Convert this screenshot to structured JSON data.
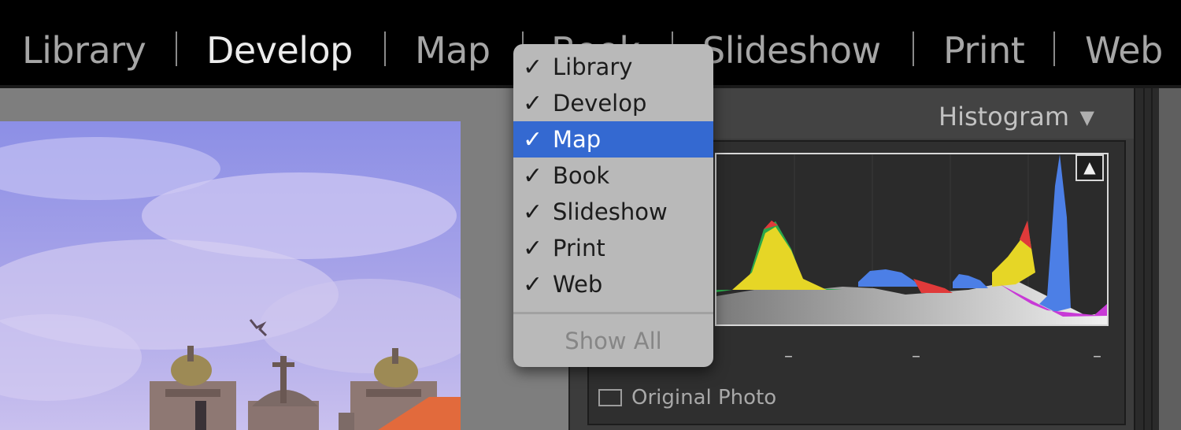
{
  "module_bar": {
    "items": [
      {
        "label": "Library",
        "active": false
      },
      {
        "label": "Develop",
        "active": true
      },
      {
        "label": "Map",
        "active": false
      },
      {
        "label": "Book",
        "active": false
      },
      {
        "label": "Slideshow",
        "active": false
      },
      {
        "label": "Print",
        "active": false
      },
      {
        "label": "Web",
        "active": false
      }
    ]
  },
  "context_menu": {
    "items": [
      {
        "check": "✓",
        "label": "Library"
      },
      {
        "check": "✓",
        "label": "Develop"
      },
      {
        "check": "✓",
        "label": "Map"
      },
      {
        "check": "✓",
        "label": "Book"
      },
      {
        "check": "✓",
        "label": "Slideshow"
      },
      {
        "check": "✓",
        "label": "Print"
      },
      {
        "check": "✓",
        "label": "Web"
      }
    ],
    "selected_index": 2,
    "show_all_label": "Show All",
    "highlight_color": "#3469d1"
  },
  "histogram_panel": {
    "title": "Histogram",
    "collapse_icon": "triangle-down-icon",
    "clip_icon": "triangle-up-icon",
    "tick_labels": [
      "–",
      "–",
      "–"
    ],
    "original_photo_label": "Original Photo"
  },
  "icons": {
    "check": "checkmark-icon",
    "triangle_down": "▼",
    "triangle_up": "▲"
  }
}
